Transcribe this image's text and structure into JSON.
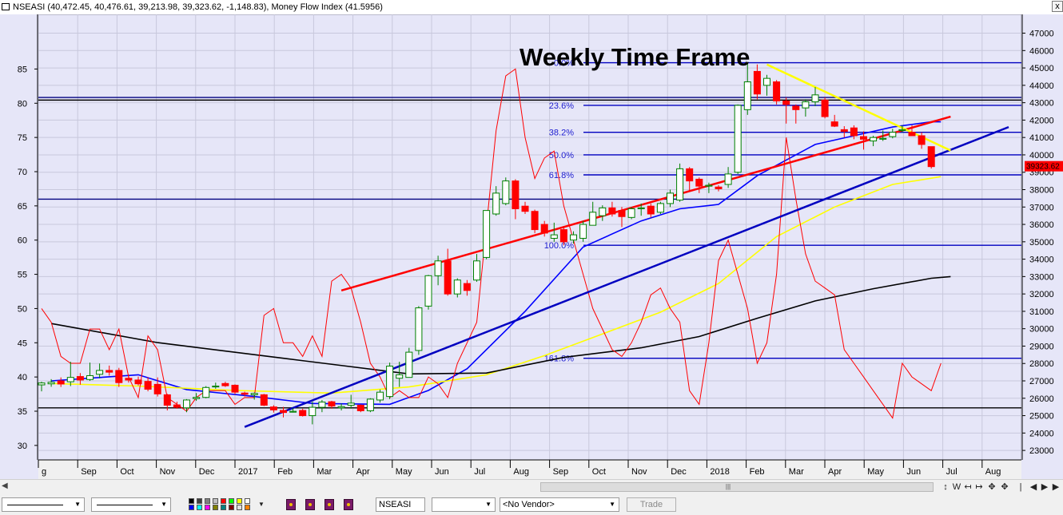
{
  "window": {
    "title_main": "NSEASI (40,472.45, 40,476.61, 39,213.98, 39,323.62, -1,148.83), Money Flow Index (41.5956)",
    "close_label": "x"
  },
  "chart_data": {
    "type": "candlestick",
    "annotation_title": "Weekly Time Frame",
    "right_axis": {
      "ticks": [
        "47000",
        "46000",
        "45000",
        "44000",
        "43000",
        "42000",
        "41000",
        "40000",
        "39000",
        "38000",
        "37000",
        "36000",
        "35000",
        "34000",
        "33000",
        "32000",
        "31000",
        "30000",
        "29000",
        "28000",
        "27000",
        "26000",
        "25000",
        "24000",
        "23000"
      ],
      "range": [
        22500,
        47300
      ]
    },
    "left_axis": {
      "ticks": [
        "85",
        "80",
        "75",
        "70",
        "65",
        "60",
        "55",
        "50",
        "45",
        "40",
        "35",
        "30"
      ],
      "range": [
        28,
        91
      ]
    },
    "x_axis": {
      "labels": [
        "g",
        "Sep",
        "Oct",
        "Nov",
        "Dec",
        "2017",
        "Feb",
        "Mar",
        "Apr",
        "May",
        "Jun",
        "Jul",
        "Aug",
        "Sep",
        "Oct",
        "Nov",
        "Dec",
        "2018",
        "Feb",
        "Mar",
        "Apr",
        "May",
        "Jun",
        "Jul",
        "Aug"
      ]
    },
    "last_price_label": "39323.62",
    "fib_levels": [
      {
        "label": "0.0%",
        "price": 45300
      },
      {
        "label": "23.6%",
        "price": 42850
      },
      {
        "label": "38.2%",
        "price": 41300
      },
      {
        "label": "50.0%",
        "price": 40000
      },
      {
        "label": "61.8%",
        "price": 38850
      },
      {
        "label": "100.0%",
        "price": 34800
      },
      {
        "label": "161.8%",
        "price": 28300
      }
    ],
    "horizontal_lines": [
      {
        "price": 43300,
        "color": "#000080"
      },
      {
        "price": 43150,
        "color": "#000000"
      },
      {
        "price": 37450,
        "color": "#000080"
      },
      {
        "price": 25450,
        "color": "#000000"
      }
    ],
    "candles": [
      {
        "o": 26770,
        "h": 26950,
        "l": 26400,
        "c": 26880
      },
      {
        "o": 26830,
        "h": 27100,
        "l": 26660,
        "c": 26920
      },
      {
        "o": 27000,
        "h": 27200,
        "l": 26650,
        "c": 26820
      },
      {
        "o": 26950,
        "h": 28100,
        "l": 26700,
        "c": 27200
      },
      {
        "o": 27250,
        "h": 27450,
        "l": 26780,
        "c": 27050
      },
      {
        "o": 27080,
        "h": 28050,
        "l": 27000,
        "c": 27300
      },
      {
        "o": 27380,
        "h": 28000,
        "l": 27150,
        "c": 27600
      },
      {
        "o": 27600,
        "h": 27880,
        "l": 27300,
        "c": 27500
      },
      {
        "o": 27600,
        "h": 27750,
        "l": 26650,
        "c": 26900
      },
      {
        "o": 27150,
        "h": 27350,
        "l": 26900,
        "c": 27050
      },
      {
        "o": 27050,
        "h": 27250,
        "l": 26730,
        "c": 26830
      },
      {
        "o": 26970,
        "h": 27200,
        "l": 26400,
        "c": 26520
      },
      {
        "o": 26800,
        "h": 27200,
        "l": 26100,
        "c": 26250
      },
      {
        "o": 26200,
        "h": 26250,
        "l": 25300,
        "c": 25600
      },
      {
        "o": 25620,
        "h": 25800,
        "l": 25400,
        "c": 25480
      },
      {
        "o": 25450,
        "h": 25950,
        "l": 25200,
        "c": 25900
      },
      {
        "o": 25980,
        "h": 26300,
        "l": 25850,
        "c": 26050
      },
      {
        "o": 26050,
        "h": 26700,
        "l": 26000,
        "c": 26620
      },
      {
        "o": 26650,
        "h": 26900,
        "l": 26550,
        "c": 26700
      },
      {
        "o": 26850,
        "h": 26950,
        "l": 26650,
        "c": 26720
      },
      {
        "o": 26750,
        "h": 26800,
        "l": 26220,
        "c": 26350
      },
      {
        "o": 26300,
        "h": 26380,
        "l": 26100,
        "c": 26230
      },
      {
        "o": 26200,
        "h": 26330,
        "l": 25920,
        "c": 26280
      },
      {
        "o": 26200,
        "h": 26250,
        "l": 25550,
        "c": 25600
      },
      {
        "o": 25500,
        "h": 25600,
        "l": 25180,
        "c": 25330
      },
      {
        "o": 25300,
        "h": 25500,
        "l": 24900,
        "c": 25180
      },
      {
        "o": 25200,
        "h": 25430,
        "l": 25180,
        "c": 25250
      },
      {
        "o": 25300,
        "h": 25400,
        "l": 24950,
        "c": 25000
      },
      {
        "o": 25000,
        "h": 25800,
        "l": 24500,
        "c": 25480
      },
      {
        "o": 25480,
        "h": 25900,
        "l": 25200,
        "c": 25780
      },
      {
        "o": 25800,
        "h": 25850,
        "l": 25400,
        "c": 25550
      },
      {
        "o": 25450,
        "h": 25700,
        "l": 25300,
        "c": 25520
      },
      {
        "o": 25600,
        "h": 26200,
        "l": 25400,
        "c": 25720
      },
      {
        "o": 25600,
        "h": 25650,
        "l": 25200,
        "c": 25280
      },
      {
        "o": 25280,
        "h": 26000,
        "l": 25200,
        "c": 25950
      },
      {
        "o": 25900,
        "h": 26500,
        "l": 25750,
        "c": 26350
      },
      {
        "o": 26100,
        "h": 28050,
        "l": 25950,
        "c": 27850
      },
      {
        "o": 27150,
        "h": 28100,
        "l": 26650,
        "c": 27350
      },
      {
        "o": 27200,
        "h": 28900,
        "l": 27200,
        "c": 28650
      },
      {
        "o": 28750,
        "h": 31300,
        "l": 28500,
        "c": 31200
      },
      {
        "o": 31300,
        "h": 33100,
        "l": 31100,
        "c": 33050
      },
      {
        "o": 33050,
        "h": 34200,
        "l": 32500,
        "c": 33900
      },
      {
        "o": 33900,
        "h": 34600,
        "l": 31900,
        "c": 32000
      },
      {
        "o": 32000,
        "h": 32900,
        "l": 31800,
        "c": 32800
      },
      {
        "o": 32600,
        "h": 32800,
        "l": 31900,
        "c": 32200
      },
      {
        "o": 32800,
        "h": 34300,
        "l": 32700,
        "c": 33900
      },
      {
        "o": 34100,
        "h": 36800,
        "l": 34000,
        "c": 36800
      },
      {
        "o": 36600,
        "h": 38200,
        "l": 36500,
        "c": 37800
      },
      {
        "o": 37200,
        "h": 38700,
        "l": 37100,
        "c": 38500
      },
      {
        "o": 38500,
        "h": 38600,
        "l": 36300,
        "c": 36900
      },
      {
        "o": 37050,
        "h": 37300,
        "l": 36600,
        "c": 36750
      },
      {
        "o": 36750,
        "h": 36850,
        "l": 35500,
        "c": 35700
      },
      {
        "o": 36000,
        "h": 36200,
        "l": 35300,
        "c": 35500
      },
      {
        "o": 35200,
        "h": 36100,
        "l": 35000,
        "c": 35400
      },
      {
        "o": 35700,
        "h": 35900,
        "l": 34800,
        "c": 35000
      },
      {
        "o": 35100,
        "h": 35600,
        "l": 34900,
        "c": 35400
      },
      {
        "o": 35200,
        "h": 36200,
        "l": 35000,
        "c": 36000
      },
      {
        "o": 35950,
        "h": 37300,
        "l": 35950,
        "c": 36700
      },
      {
        "o": 36500,
        "h": 37100,
        "l": 36200,
        "c": 36950
      },
      {
        "o": 36950,
        "h": 37300,
        "l": 36450,
        "c": 36600
      },
      {
        "o": 36800,
        "h": 37000,
        "l": 35850,
        "c": 36450
      },
      {
        "o": 36400,
        "h": 37000,
        "l": 36300,
        "c": 36900
      },
      {
        "o": 36900,
        "h": 37200,
        "l": 36500,
        "c": 36950
      },
      {
        "o": 37050,
        "h": 37200,
        "l": 36400,
        "c": 36600
      },
      {
        "o": 36700,
        "h": 37300,
        "l": 36600,
        "c": 37200
      },
      {
        "o": 37200,
        "h": 38000,
        "l": 37000,
        "c": 37800
      },
      {
        "o": 37400,
        "h": 39500,
        "l": 37300,
        "c": 39200
      },
      {
        "o": 39200,
        "h": 39300,
        "l": 37900,
        "c": 38500
      },
      {
        "o": 38600,
        "h": 38700,
        "l": 37800,
        "c": 38200
      },
      {
        "o": 38200,
        "h": 38400,
        "l": 37800,
        "c": 38250
      },
      {
        "o": 38150,
        "h": 38250,
        "l": 37900,
        "c": 38050
      },
      {
        "o": 38300,
        "h": 39300,
        "l": 38100,
        "c": 38900
      },
      {
        "o": 39000,
        "h": 42900,
        "l": 38900,
        "c": 42850
      },
      {
        "o": 42600,
        "h": 45300,
        "l": 42300,
        "c": 44200
      },
      {
        "o": 44800,
        "h": 45200,
        "l": 43200,
        "c": 43500
      },
      {
        "o": 44000,
        "h": 44600,
        "l": 43400,
        "c": 44400
      },
      {
        "o": 44200,
        "h": 44300,
        "l": 42900,
        "c": 43100
      },
      {
        "o": 43100,
        "h": 43300,
        "l": 41800,
        "c": 42900
      },
      {
        "o": 42800,
        "h": 42900,
        "l": 41800,
        "c": 42600
      },
      {
        "o": 42700,
        "h": 43200,
        "l": 42200,
        "c": 43050
      },
      {
        "o": 43050,
        "h": 43900,
        "l": 42800,
        "c": 43450
      },
      {
        "o": 43150,
        "h": 43300,
        "l": 42100,
        "c": 42200
      },
      {
        "o": 41900,
        "h": 42300,
        "l": 41600,
        "c": 41650
      },
      {
        "o": 41450,
        "h": 41650,
        "l": 41000,
        "c": 41350
      },
      {
        "o": 41550,
        "h": 41700,
        "l": 40900,
        "c": 41100
      },
      {
        "o": 41050,
        "h": 41350,
        "l": 40300,
        "c": 40900
      },
      {
        "o": 40800,
        "h": 41100,
        "l": 40500,
        "c": 41000
      },
      {
        "o": 40900,
        "h": 41400,
        "l": 40800,
        "c": 40950
      },
      {
        "o": 41050,
        "h": 41500,
        "l": 40950,
        "c": 41300
      },
      {
        "o": 41400,
        "h": 41700,
        "l": 41300,
        "c": 41450
      },
      {
        "o": 41300,
        "h": 41700,
        "l": 41100,
        "c": 41100
      },
      {
        "o": 41100,
        "h": 41300,
        "l": 40350,
        "c": 40600
      },
      {
        "o": 40472.45,
        "h": 40476.61,
        "l": 39213.98,
        "c": 39323.62
      }
    ],
    "series": [
      {
        "role": "moving-average",
        "color": "#0000ff",
        "values": [
          [
            1,
            27000
          ],
          [
            10,
            27350
          ],
          [
            15,
            26500
          ],
          [
            22,
            26100
          ],
          [
            28,
            25700
          ],
          [
            36,
            25650
          ],
          [
            40,
            26450
          ],
          [
            44,
            27700
          ],
          [
            50,
            31000
          ],
          [
            56,
            34700
          ],
          [
            62,
            36200
          ],
          [
            66,
            36900
          ],
          [
            70,
            37150
          ],
          [
            74,
            38800
          ],
          [
            80,
            40600
          ],
          [
            84,
            41100
          ],
          [
            88,
            41600
          ],
          [
            92,
            41900
          ],
          [
            93,
            41900
          ]
        ]
      },
      {
        "role": "moving-average",
        "color": "#ffff00",
        "values": [
          [
            1,
            26850
          ],
          [
            10,
            26700
          ],
          [
            20,
            26450
          ],
          [
            30,
            26300
          ],
          [
            38,
            26650
          ],
          [
            46,
            27350
          ],
          [
            52,
            28450
          ],
          [
            58,
            29700
          ],
          [
            64,
            30950
          ],
          [
            70,
            32600
          ],
          [
            76,
            35300
          ],
          [
            82,
            37000
          ],
          [
            88,
            38300
          ],
          [
            93,
            38750
          ]
        ]
      },
      {
        "role": "moving-average",
        "color": "#000000",
        "values": [
          [
            1,
            30300
          ],
          [
            12,
            29200
          ],
          [
            25,
            28300
          ],
          [
            38,
            27400
          ],
          [
            46,
            27450
          ],
          [
            54,
            28350
          ],
          [
            62,
            28900
          ],
          [
            68,
            29550
          ],
          [
            74,
            30600
          ],
          [
            80,
            31600
          ],
          [
            86,
            32300
          ],
          [
            92,
            32900
          ],
          [
            94,
            33000
          ]
        ]
      }
    ],
    "mfi_indicator": {
      "color": "#ff0000",
      "values": [
        50,
        48,
        43,
        42,
        42,
        47,
        47,
        44,
        47,
        40,
        37,
        46,
        44,
        37,
        36,
        35,
        37,
        38,
        38,
        38,
        36,
        37,
        37,
        49,
        50,
        45,
        45,
        43,
        46,
        43,
        54,
        55,
        53,
        48,
        42,
        40,
        37,
        38,
        37,
        37,
        40,
        39,
        37,
        42,
        45,
        48,
        62,
        76,
        84,
        85,
        75,
        69,
        72,
        73,
        65,
        60,
        55,
        50,
        47,
        44,
        43,
        45,
        48,
        52,
        53,
        50,
        48,
        38,
        36,
        45,
        57,
        60,
        55,
        50,
        42,
        45,
        55,
        75,
        66,
        58,
        54,
        53,
        52,
        44,
        42,
        40,
        38,
        36,
        34,
        42,
        40,
        39,
        38,
        42
      ]
    },
    "trend_lines": [
      {
        "color": "#ff0000",
        "from": [
          31,
          32200
        ],
        "to": [
          94,
          42200
        ]
      },
      {
        "color": "#0000c0",
        "from": [
          21,
          24350
        ],
        "to": [
          100,
          41600
        ]
      },
      {
        "color": "#ffff00",
        "from": [
          75,
          45200
        ],
        "to": [
          94,
          40250
        ]
      }
    ],
    "grid": true
  },
  "toolbar": {
    "symbol_value": "NSEASI",
    "vendor_value": "<No Vendor>",
    "trade_label": "Trade",
    "palette_colors": [
      "#000000",
      "#404040",
      "#808080",
      "#c0c0c0",
      "#ff0000",
      "#00ff00",
      "#ffff00",
      "#ffffff",
      "#0000ff",
      "#00ffff",
      "#ff00ff",
      "#808000",
      "#008080",
      "#800000",
      "#e0e0e0",
      "#ff8000"
    ]
  },
  "nav": {
    "zoom_fit_label": "↕",
    "w_label": "W",
    "left_label": "◀",
    "right_label": "▶",
    "crosshair_label": "✥"
  }
}
